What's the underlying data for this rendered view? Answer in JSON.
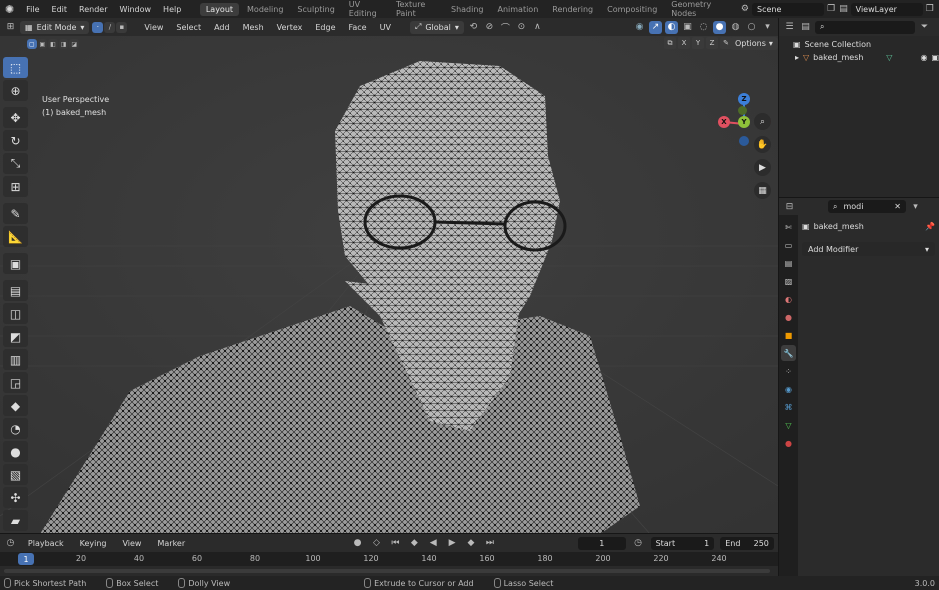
{
  "topbar": {
    "menus": [
      "File",
      "Edit",
      "Render",
      "Window",
      "Help"
    ],
    "workspaces": [
      "Layout",
      "Modeling",
      "Sculpting",
      "UV Editing",
      "Texture Paint",
      "Shading",
      "Animation",
      "Rendering",
      "Compositing",
      "Geometry Nodes"
    ],
    "active_workspace": "Layout",
    "scene": "Scene",
    "view_layer": "ViewLayer"
  },
  "viewport_header": {
    "mode": "Edit Mode",
    "menus": [
      "View",
      "Select",
      "Add",
      "Mesh",
      "Vertex",
      "Edge",
      "Face",
      "UV"
    ],
    "orientation": "Global",
    "options": "Options",
    "axes": [
      "X",
      "Y",
      "Z"
    ]
  },
  "viewport": {
    "view_name": "User Perspective",
    "object_label": "(1) baked_mesh",
    "gizmo": {
      "x": "X",
      "y": "Y",
      "z": "Z"
    }
  },
  "timeline": {
    "menus": [
      "Playback",
      "Keying",
      "View",
      "Marker"
    ],
    "current_frame": "1",
    "start_label": "Start",
    "start": "1",
    "end_label": "End",
    "end": "250",
    "ticks": [
      "20",
      "40",
      "60",
      "80",
      "100",
      "120",
      "140",
      "160",
      "180",
      "200",
      "220",
      "240"
    ],
    "ruler_frame": "1"
  },
  "statusbar": {
    "items": [
      "Pick Shortest Path",
      "Box Select",
      "Dolly View",
      "Extrude to Cursor or Add",
      "Lasso Select"
    ],
    "version": "3.0.0"
  },
  "outliner": {
    "collection": "Scene Collection",
    "object": "baked_mesh"
  },
  "properties": {
    "search": "modi",
    "object": "baked_mesh",
    "add_modifier": "Add Modifier"
  },
  "colors": {
    "accent": "#4772b3",
    "x_axis": "#e05060",
    "y_axis": "#8fc23a",
    "z_axis": "#3c7fd8"
  }
}
